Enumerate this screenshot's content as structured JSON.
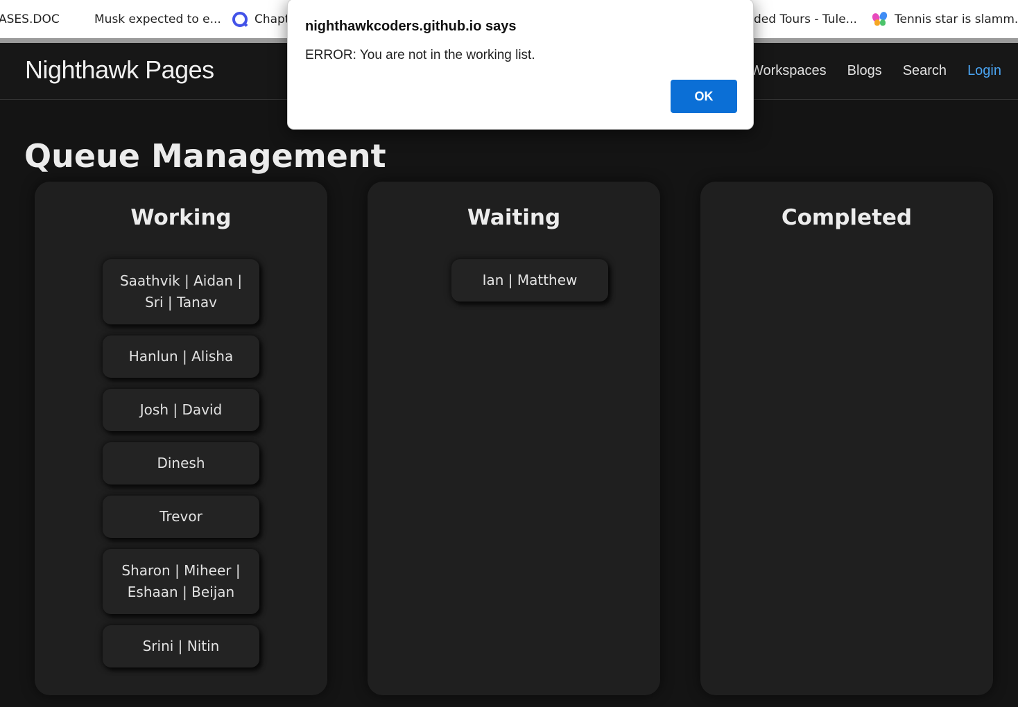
{
  "bookmarks": [
    {
      "label": "ASES.DOC",
      "icon": "none"
    },
    {
      "label": "Musk expected to e...",
      "icon": "microsoft-icon"
    },
    {
      "label": "Chapt",
      "icon": "q-icon"
    },
    {
      "label": "ded Tours - Tule...",
      "icon": "none"
    },
    {
      "label": "Tennis star is slamm...",
      "icon": "butterfly-icon"
    }
  ],
  "navbar": {
    "brand": "Nighthawk Pages",
    "links": [
      "Workspaces",
      "Blogs",
      "Search",
      "Login"
    ]
  },
  "page": {
    "title": "Queue Management"
  },
  "columns": [
    {
      "title": "Working",
      "items": [
        "Saathvik | Aidan | Sri | Tanav",
        "Hanlun | Alisha",
        "Josh | David",
        "Dinesh",
        "Trevor",
        "Sharon | Miheer | Eshaan | Beijan",
        "Srini | Nitin"
      ]
    },
    {
      "title": "Waiting",
      "items": [
        "Ian | Matthew"
      ]
    },
    {
      "title": "Completed",
      "items": []
    }
  ],
  "dialog": {
    "title": "nighthawkcoders.github.io says",
    "message": "ERROR: You are not in the working list.",
    "ok_label": "OK"
  },
  "colors": {
    "background": "#141414",
    "column": "#1f1f1f",
    "card": "#232323",
    "login_link": "#4aa3f0",
    "ok_button": "#0b6fd6"
  }
}
